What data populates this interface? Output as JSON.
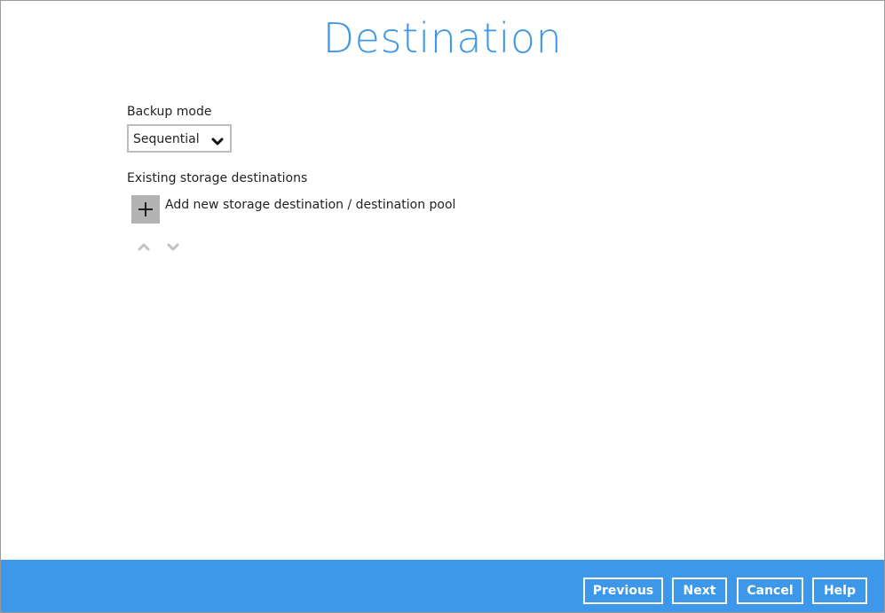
{
  "page": {
    "title": "Destination"
  },
  "backup_mode": {
    "label": "Backup mode",
    "selected": "Sequential"
  },
  "storage": {
    "existing_label": "Existing storage destinations",
    "add_label": "Add new storage destination / destination pool"
  },
  "icons": {
    "add": "plus-icon",
    "dropdown": "chevron-down-icon",
    "move_up": "chevron-up-icon",
    "move_down": "chevron-down-icon"
  },
  "colors": {
    "title": "#3f97e6",
    "footer": "#3d98ea",
    "add_button": "#b3b3b3"
  },
  "footer": {
    "previous": "Previous",
    "next": "Next",
    "cancel": "Cancel",
    "help": "Help"
  }
}
